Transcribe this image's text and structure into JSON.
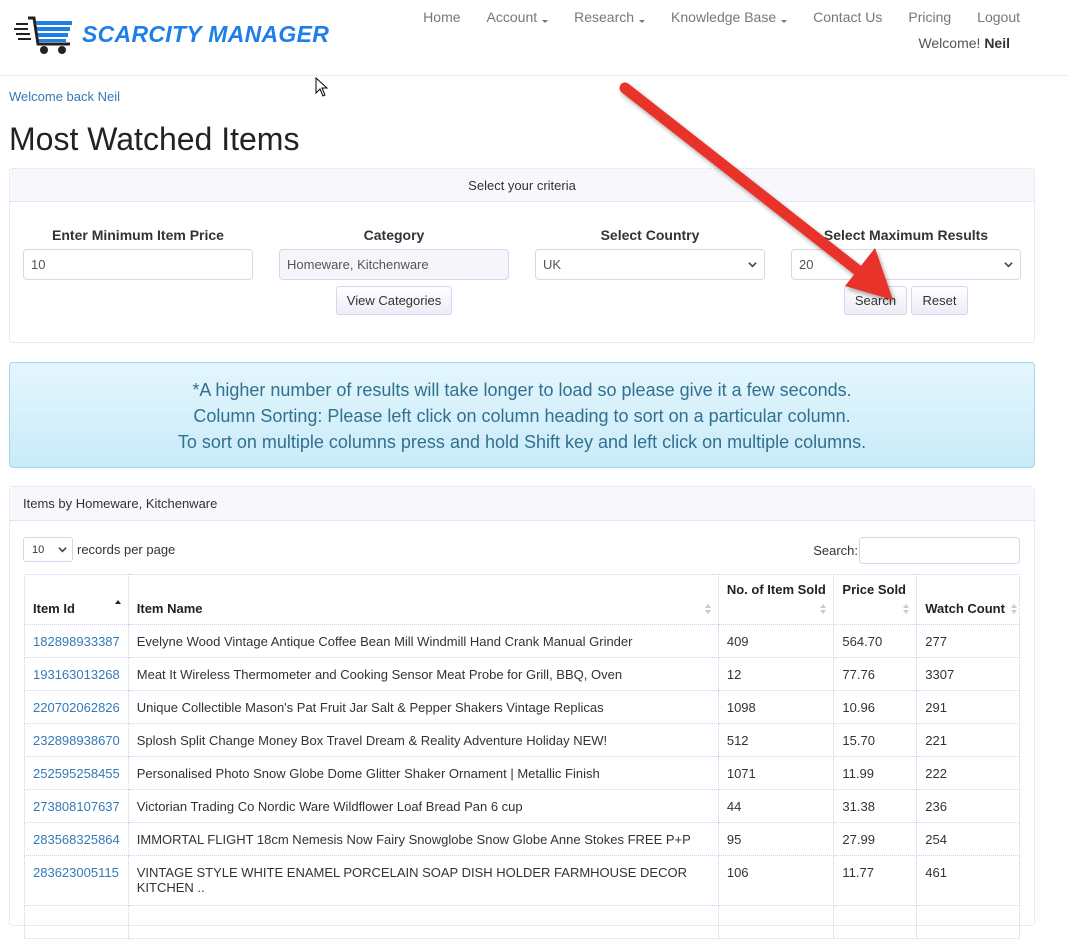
{
  "brand": {
    "name": "SCARCITY MANAGER",
    "color": "#1e7fe6"
  },
  "nav": {
    "items": [
      {
        "label": "Home",
        "dropdown": false
      },
      {
        "label": "Account",
        "dropdown": true
      },
      {
        "label": "Research",
        "dropdown": true
      },
      {
        "label": "Knowledge Base",
        "dropdown": true
      },
      {
        "label": "Contact Us",
        "dropdown": false
      },
      {
        "label": "Pricing",
        "dropdown": false
      },
      {
        "label": "Logout",
        "dropdown": false
      }
    ],
    "welcome_prefix": "Welcome!",
    "welcome_user": "Neil"
  },
  "welcome_back": "Welcome back Neil",
  "page_title": "Most Watched Items",
  "criteria": {
    "heading": "Select your criteria",
    "min_price": {
      "label": "Enter Minimum Item Price",
      "value": "10"
    },
    "category": {
      "label": "Category",
      "value": "Homeware, Kitchenware"
    },
    "country": {
      "label": "Select Country",
      "value": "UK"
    },
    "max_results": {
      "label": "Select Maximum Results",
      "value": "20"
    },
    "view_categories_label": "View Categories",
    "search_label": "Search",
    "reset_label": "Reset"
  },
  "info": {
    "lines": [
      "*A higher number of results will take longer to load so please give it a few seconds.",
      "Column Sorting: Please left click on column heading to sort on a particular column.",
      "To sort on multiple columns press and hold Shift key and left click on multiple columns."
    ],
    "color": "#31708f"
  },
  "results": {
    "heading": "Items by Homeware, Kitchenware",
    "page_length": "10",
    "page_length_suffix": "records per page",
    "search_label": "Search:",
    "search_value": "",
    "columns": [
      "Item Id",
      "Item Name",
      "No. of Item Sold",
      "Price Sold",
      "Watch Count"
    ],
    "sorted_column": "Item Id",
    "rows": [
      {
        "id": "182898933387",
        "name": "Evelyne Wood Vintage Antique Coffee Bean Mill Windmill Hand Crank Manual Grinder",
        "sold": "409",
        "price": "564.70",
        "watch": "277"
      },
      {
        "id": "193163013268",
        "name": "Meat It Wireless Thermometer and Cooking Sensor Meat Probe for Grill, BBQ, Oven",
        "sold": "12",
        "price": "77.76",
        "watch": "3307"
      },
      {
        "id": "220702062826",
        "name": "Unique Collectible Mason's Pat Fruit Jar Salt & Pepper Shakers Vintage Replicas",
        "sold": "1098",
        "price": "10.96",
        "watch": "291"
      },
      {
        "id": "232898938670",
        "name": "Splosh Split Change Money Box Travel Dream & Reality Adventure Holiday NEW!",
        "sold": "512",
        "price": "15.70",
        "watch": "221"
      },
      {
        "id": "252595258455",
        "name": "Personalised Photo Snow Globe Dome Glitter Shaker Ornament | Metallic Finish",
        "sold": "1071",
        "price": "11.99",
        "watch": "222"
      },
      {
        "id": "273808107637",
        "name": "Victorian Trading Co Nordic Ware Wildflower Loaf Bread Pan 6 cup",
        "sold": "44",
        "price": "31.38",
        "watch": "236"
      },
      {
        "id": "283568325864",
        "name": "IMMORTAL FLIGHT 18cm Nemesis Now Fairy Snowglobe Snow Globe Anne Stokes FREE P+P",
        "sold": "95",
        "price": "27.99",
        "watch": "254"
      },
      {
        "id": "283623005115",
        "name": "VINTAGE STYLE WHITE ENAMEL PORCELAIN SOAP DISH HOLDER FARMHOUSE DECOR KITCHEN ..",
        "sold": "106",
        "price": "11.77",
        "watch": "461"
      }
    ]
  },
  "annotation": {
    "type": "red-arrow",
    "points_to": "Search",
    "color": "#e8302c"
  }
}
